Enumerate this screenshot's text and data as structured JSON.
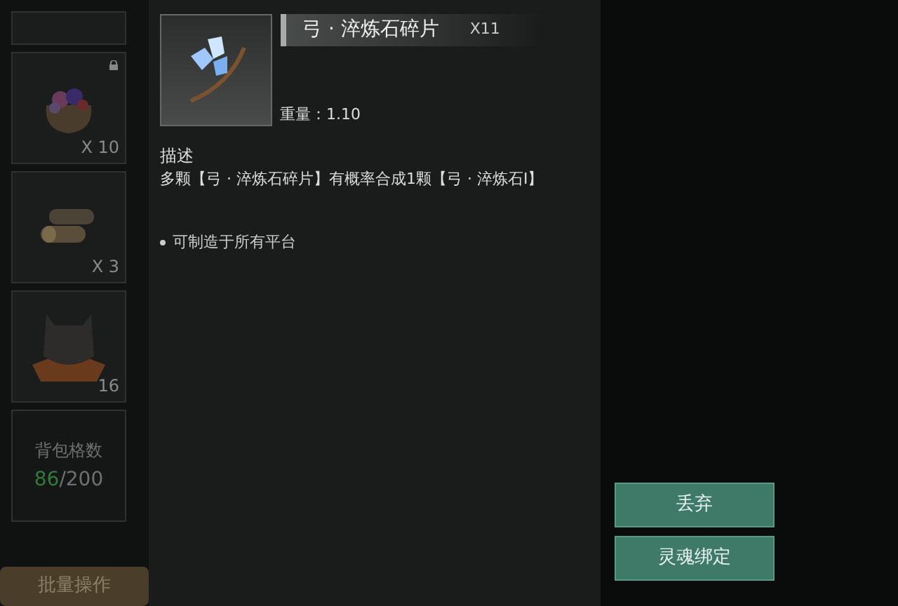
{
  "inventory": {
    "slots": [
      {
        "kind": "partial",
        "locked": false
      },
      {
        "kind": "sack",
        "count": "X 10",
        "locked": true
      },
      {
        "kind": "logs",
        "count": "X 3",
        "locked": false
      },
      {
        "kind": "helmet",
        "count": "16",
        "locked": false
      }
    ],
    "capacity": {
      "label": "背包格数",
      "used": "86",
      "total": "/200"
    },
    "batch_button": "批量操作"
  },
  "tooltip": {
    "name": "弓 · 淬炼石碎片",
    "quantity": "X11",
    "weight": "重量：1.10",
    "description_title": "描述",
    "description": "多颗【弓 · 淬炼石碎片】有概率合成1颗【弓 · 淬炼石I】",
    "notes": [
      "可制造于所有平台"
    ]
  },
  "actions": [
    "丢弃",
    "灵魂绑定"
  ]
}
